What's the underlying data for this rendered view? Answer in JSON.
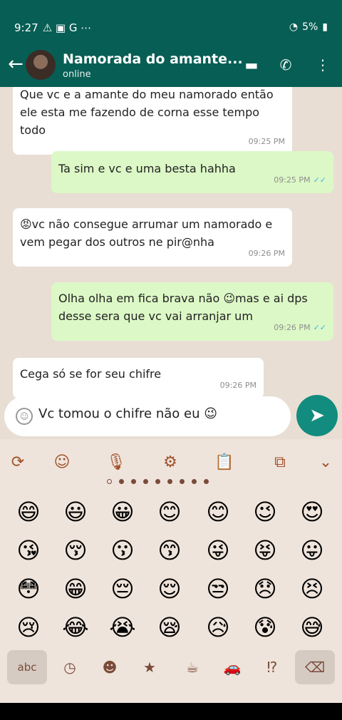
{
  "status_bar": {
    "time": "9:27",
    "battery": "5%"
  },
  "header": {
    "contact_name": "Namorada do amante...",
    "status": "online"
  },
  "messages": [
    {
      "direction": "in",
      "text": "Que vc e a amante do meu namorado então ele esta me fazendo de corna esse tempo todo",
      "time": "09:25 PM"
    },
    {
      "direction": "out",
      "text": "Ta sim e vc e uma besta hahha",
      "time": "09:25 PM"
    },
    {
      "direction": "in",
      "text": "😡vc não consegue arrumar um namorado e vem pegar dos outros ne pir@nha",
      "time": "09:26 PM"
    },
    {
      "direction": "out",
      "text": "Olha olha em fica brava não 😉mas e ai dps desse sera que vc vai arranjar um",
      "time": "09:26 PM"
    },
    {
      "direction": "in",
      "text": "Cega só se for seu chifre",
      "time": "09:26 PM"
    }
  ],
  "input": {
    "value": "Vc tomou o chifre não eu 😉"
  },
  "keyboard": {
    "emoji_rows": [
      [
        "😄",
        "😃",
        "😀",
        "😊",
        "😊",
        "😉",
        "😍"
      ],
      [
        "😘",
        "😚",
        "😗",
        "😙",
        "😜",
        "😝",
        "😛"
      ],
      [
        "😳",
        "😁",
        "😔",
        "😌",
        "😒",
        "😞",
        "😣"
      ],
      [
        "😢",
        "😂",
        "😭",
        "😪",
        "😥",
        "😰",
        "😅"
      ]
    ],
    "abc_label": "abc"
  },
  "colors": {
    "header": "#075e54",
    "outgoing_bubble": "#dcf8c6",
    "chat_bg": "#e8ded3",
    "send_button": "#128c7e",
    "read_ticks": "#34b7f1"
  }
}
